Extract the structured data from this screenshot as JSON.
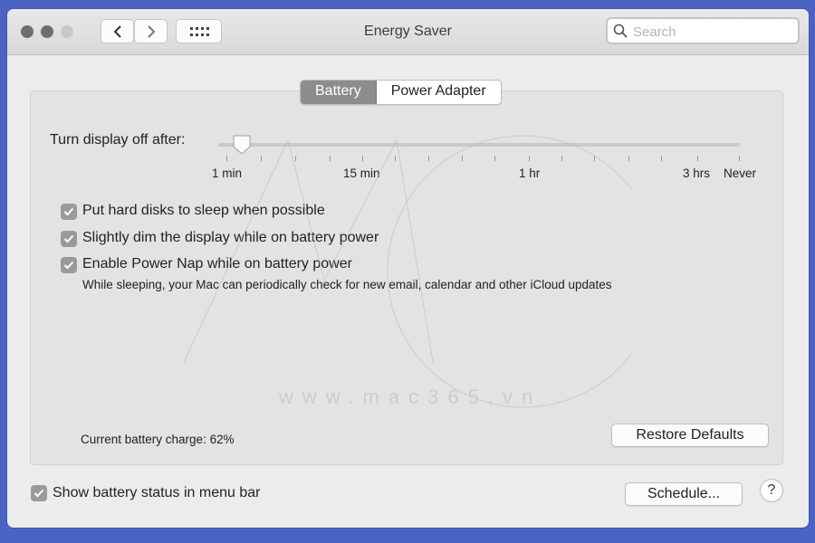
{
  "window": {
    "title": "Energy Saver"
  },
  "search": {
    "placeholder": "Search"
  },
  "tabs": [
    {
      "label": "Battery",
      "active": true
    },
    {
      "label": "Power Adapter",
      "active": false
    }
  ],
  "display_sleep": {
    "label": "Turn display off after:",
    "tick_labels": [
      "1 min",
      "15 min",
      "1 hr",
      "3 hrs",
      "Never"
    ],
    "selected": "1 min"
  },
  "options": [
    {
      "label": "Put hard disks to sleep when possible",
      "checked": true
    },
    {
      "label": "Slightly dim the display while on battery power",
      "checked": true
    },
    {
      "label": "Enable Power Nap while on battery power",
      "checked": true,
      "description": "While sleeping, your Mac can periodically check for new email, calendar and other iCloud updates"
    }
  ],
  "battery_charge": {
    "text": "Current battery charge: 62%",
    "percent": 62
  },
  "buttons": {
    "restore_defaults": "Restore Defaults",
    "schedule": "Schedule...",
    "help": "?"
  },
  "menu_bar_status": {
    "label": "Show battery status in menu bar",
    "checked": true
  },
  "watermark": {
    "text": "www.mac365.vn"
  },
  "colors": {
    "checkbox": "#9a9a9a",
    "active_tab": "#8d8d8d",
    "desktop": "#4a63c2"
  }
}
